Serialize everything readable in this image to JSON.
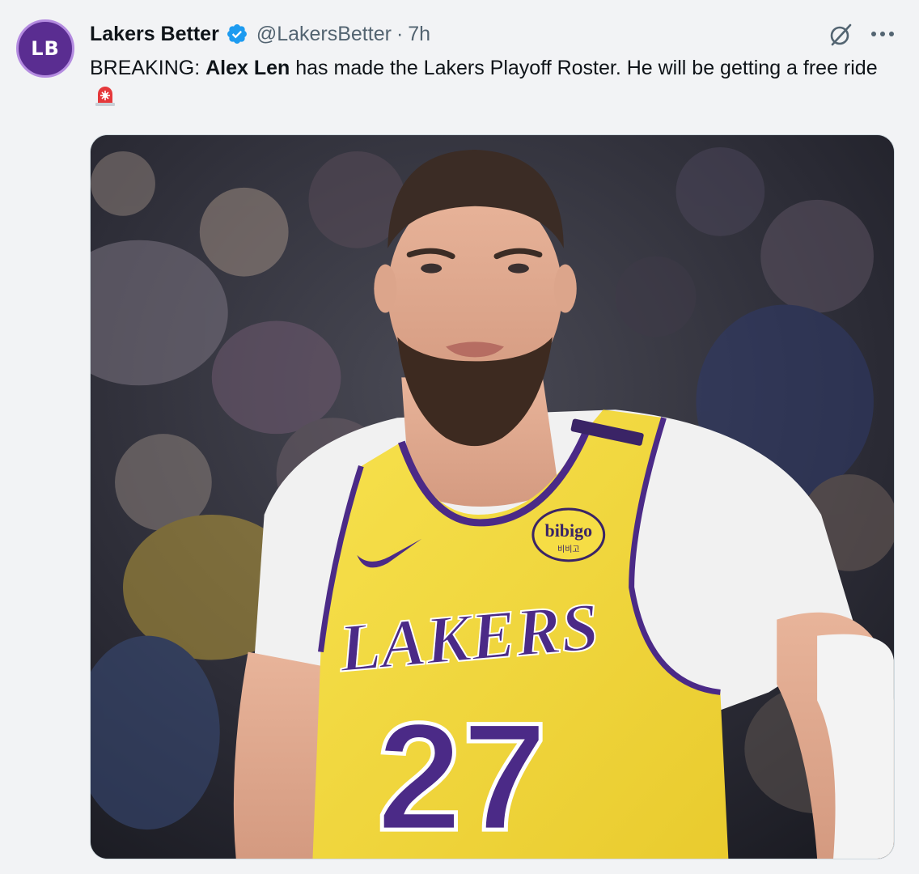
{
  "tweet": {
    "avatar_initials": "LB",
    "display_name": "Lakers Better",
    "handle": "@LakersBetter",
    "separator": "·",
    "time": "7h",
    "text_prefix": "BREAKING: ",
    "text_bold": "Alex Len",
    "text_rest": " has made the Lakers Playoff Roster. He will be getting a free ride",
    "emoji": "rotating-light",
    "icons": [
      "verified-badge-icon",
      "grok-icon",
      "more-icon"
    ],
    "colors": {
      "avatar_bg": "#5a2d91",
      "verified": "#1d9bf0",
      "jersey_yellow": "#f3db3f",
      "jersey_purple": "#4b2a87"
    }
  },
  "media": {
    "jersey_wordmark": "LAKERS",
    "jersey_number": "27",
    "sponsor_patch": "bibigo",
    "sponsor_patch_sub": "비비고"
  }
}
